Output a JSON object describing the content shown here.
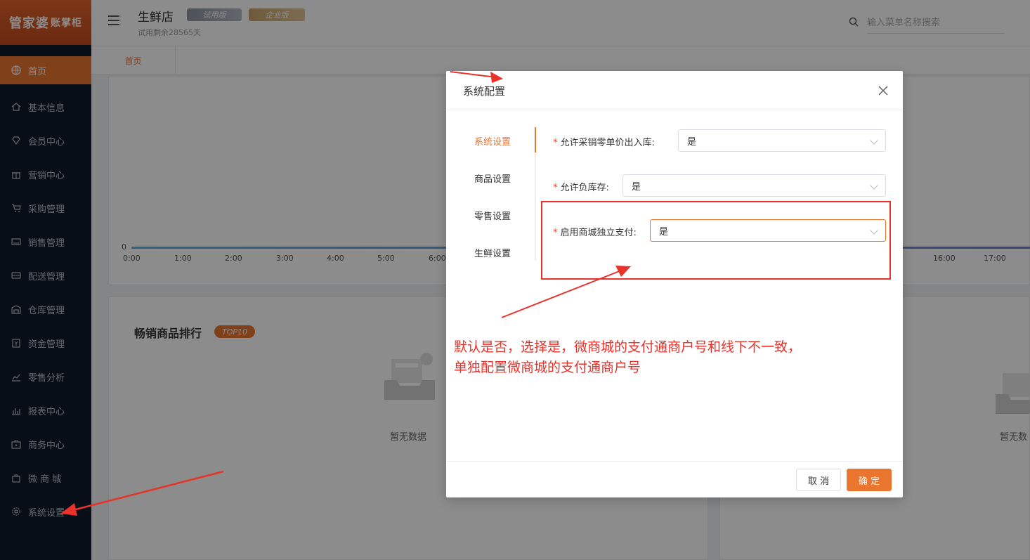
{
  "brand": {
    "logo_main": "管家婆",
    "logo_sub": "账掌柜"
  },
  "sidebar": {
    "items": [
      {
        "label": "首页",
        "icon": "globe-icon",
        "active": true
      },
      {
        "label": "基本信息",
        "icon": "home-icon"
      },
      {
        "label": "会员中心",
        "icon": "diamond-icon"
      },
      {
        "label": "营销中心",
        "icon": "gift-icon"
      },
      {
        "label": "采购管理",
        "icon": "cart-icon"
      },
      {
        "label": "销售管理",
        "icon": "keyboard-icon"
      },
      {
        "label": "配送管理",
        "icon": "truck-icon"
      },
      {
        "label": "仓库管理",
        "icon": "warehouse-icon"
      },
      {
        "label": "资金管理",
        "icon": "fund-icon"
      },
      {
        "label": "零售分析",
        "icon": "chart-icon"
      },
      {
        "label": "报表中心",
        "icon": "bar-chart-icon"
      },
      {
        "label": "商务中心",
        "icon": "briefcase-icon"
      },
      {
        "label": "微 商 城",
        "icon": "bag-icon"
      },
      {
        "label": "系统设置",
        "icon": "gear-icon"
      }
    ]
  },
  "header": {
    "store_name": "生鲜店",
    "badge_trial": "试用版",
    "badge_enterprise": "企业版",
    "trial_left": "试用剩余28565天",
    "search_placeholder": "输入菜单名称搜索"
  },
  "tabs": [
    {
      "label": "首页"
    }
  ],
  "chart": {
    "y_zero": "0",
    "x_ticks_left": [
      "0:00",
      "1:00",
      "2:00",
      "3:00",
      "4:00",
      "5:00",
      "6:00"
    ],
    "x_ticks_right": [
      "16:00",
      "17:00"
    ]
  },
  "rank": {
    "title": "畅销商品排行",
    "badge": "TOP10",
    "empty_text": "暂无数据",
    "empty_text_cut": "暂无数"
  },
  "modal": {
    "title": "系统配置",
    "side_tabs": [
      {
        "label": "系统设置",
        "active": true
      },
      {
        "label": "商品设置"
      },
      {
        "label": "零售设置"
      },
      {
        "label": "生鲜设置"
      }
    ],
    "fields": [
      {
        "label": "允许采销零单价出入库:",
        "value": "是"
      },
      {
        "label": "允许负库存:",
        "value": "是"
      },
      {
        "label": "启用商城独立支付:",
        "value": "是"
      }
    ],
    "cancel_label": "取 消",
    "ok_label": "确 定"
  },
  "annotation": {
    "line1": "默认是否，选择是，微商城的支付通商户号和线下不一致，",
    "line2": "单独配置微商城的支付通商户号"
  }
}
